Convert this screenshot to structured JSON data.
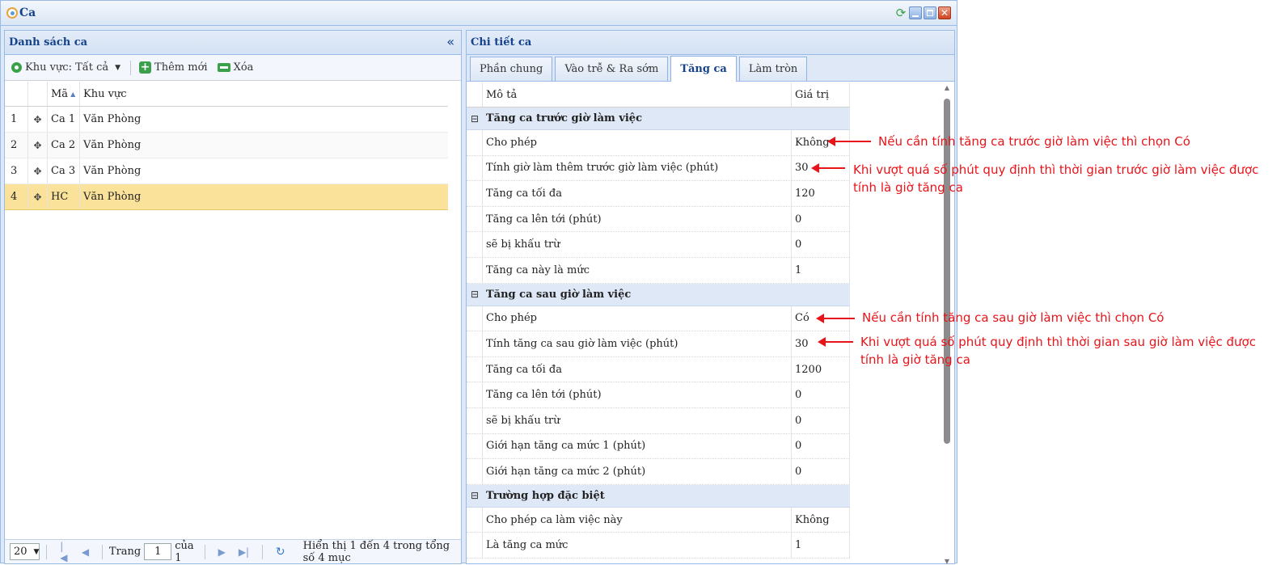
{
  "window": {
    "title": "Ca"
  },
  "left_panel": {
    "title": "Danh sách ca",
    "toolbar": {
      "area_filter": "Khu vực: Tất cả",
      "add_label": "Thêm mới",
      "delete_label": "Xóa"
    },
    "columns": {
      "code": "Mã",
      "area": "Khu vực"
    },
    "rows": [
      {
        "num": "1",
        "code": "Ca 1",
        "area": "Văn Phòng"
      },
      {
        "num": "2",
        "code": "Ca 2",
        "area": "Văn Phòng"
      },
      {
        "num": "3",
        "code": "Ca 3",
        "area": "Văn Phòng"
      },
      {
        "num": "4",
        "code": "HC",
        "area": "Văn Phòng"
      }
    ],
    "pager": {
      "page_size": "20",
      "page_label": "Trang",
      "page": "1",
      "of_label": "của 1",
      "info": "Hiển thị 1 đến 4 trong tổng số 4 mục"
    }
  },
  "right_panel": {
    "title": "Chi tiết ca",
    "tabs": [
      "Phần chung",
      "Vào trễ & Ra sớm",
      "Tăng ca",
      "Làm tròn"
    ],
    "active_tab": "Tăng ca",
    "columns": {
      "desc": "Mô tả",
      "value": "Giá trị"
    },
    "groups": [
      {
        "title": "Tăng ca trước giờ làm việc",
        "rows": [
          {
            "desc": "Cho phép",
            "value": "Không"
          },
          {
            "desc": "Tính giờ làm thêm trước giờ làm việc (phút)",
            "value": "30"
          },
          {
            "desc": "Tăng ca tối đa",
            "value": "120"
          },
          {
            "desc": "Tăng ca lên tới (phút)",
            "value": "0"
          },
          {
            "desc": "sẽ bị khấu trừ",
            "value": "0"
          },
          {
            "desc": "Tăng ca này là mức",
            "value": "1"
          }
        ]
      },
      {
        "title": "Tăng ca sau giờ làm việc",
        "rows": [
          {
            "desc": "Cho phép",
            "value": "Có"
          },
          {
            "desc": "Tính tăng ca sau giờ làm việc (phút)",
            "value": "30"
          },
          {
            "desc": "Tăng ca tối đa",
            "value": "1200"
          },
          {
            "desc": "Tăng ca lên tới (phút)",
            "value": "0"
          },
          {
            "desc": "sẽ bị khấu trừ",
            "value": "0"
          },
          {
            "desc": "Giới hạn tăng ca mức 1 (phút)",
            "value": "0"
          },
          {
            "desc": "Giới hạn tăng ca mức 2 (phút)",
            "value": "0"
          }
        ]
      },
      {
        "title": "Trường hợp đặc biệt",
        "rows": [
          {
            "desc": "Cho phép ca làm việc này",
            "value": "Không"
          },
          {
            "desc": "Là tăng ca mức",
            "value": "1"
          }
        ]
      }
    ]
  },
  "annotations": {
    "a1": "Nếu cần tính tăng ca trước giờ làm việc thì chọn Có",
    "a2_line1": "Khi vượt quá số phút quy định thì thời gian trước giờ làm việc được",
    "a2_line2": "tính là giờ tăng ca",
    "a3": "Nếu cần tính tăng ca sau giờ làm việc thì chọn Có",
    "a4_line1": "Khi vượt quá số phút quy định thì thời gian sau giờ làm việc được",
    "a4_line2": "tính là giờ tăng ca",
    "color": "#e8141a"
  }
}
